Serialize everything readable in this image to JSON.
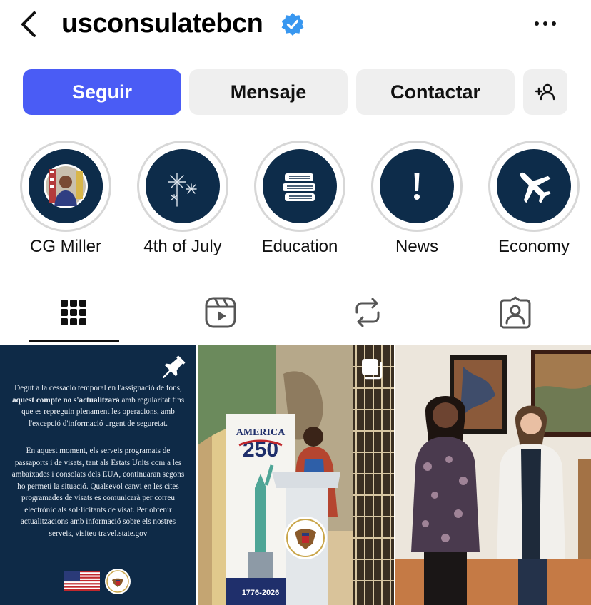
{
  "header": {
    "username": "usconsulatebcn",
    "back_icon": "chevron-left-icon",
    "verified_icon": "verified-badge-icon",
    "more_icon": "more-horizontal-icon"
  },
  "actions": {
    "follow": "Seguir",
    "message": "Mensaje",
    "contact": "Contactar",
    "suggest_icon": "add-person-icon"
  },
  "highlights": [
    {
      "label": "CG Miller",
      "icon": "portrait-photo"
    },
    {
      "label": "4th of July",
      "icon": "fireworks-icon"
    },
    {
      "label": "Education",
      "icon": "books-icon"
    },
    {
      "label": "News",
      "icon": "exclamation-icon"
    },
    {
      "label": "Economy",
      "icon": "airplane-icon"
    }
  ],
  "tabs": [
    {
      "name": "posts",
      "icon": "grid-icon",
      "active": true
    },
    {
      "name": "reels",
      "icon": "reels-icon",
      "active": false
    },
    {
      "name": "reposts",
      "icon": "repost-icon",
      "active": false
    },
    {
      "name": "tagged",
      "icon": "tagged-person-icon",
      "active": false
    }
  ],
  "posts": {
    "notice_p1_a": "Degut a la cessació temporal en l'assignació de fons,",
    "notice_p1_b": "aquest compte no s'actualitzarà",
    "notice_p1_c": "amb regularitat fins que es repreguin plenament les operacions, amb l'excepció d'informació urgent de seguretat.",
    "notice_p2": "En aquest moment, els serveis programats de passaports i de visats, tant als Estats Units com a les ambaixades i consolats dels EUA, continuaran segons ho permeti la situació. Qualsevol canvi en les cites programades de visats es comunicarà per correu electrònic als sol·licitants de visat. Per obtenir actualitzacions amb informació sobre els nostres serveis, visiteu travel.state.gov",
    "banner_title": "AMERICA",
    "banner_number": "250",
    "banner_years": "1776-2026"
  },
  "colors": {
    "primary": "#4a5cf5",
    "navy": "#0d2c4a",
    "verified": "#3897f0"
  }
}
